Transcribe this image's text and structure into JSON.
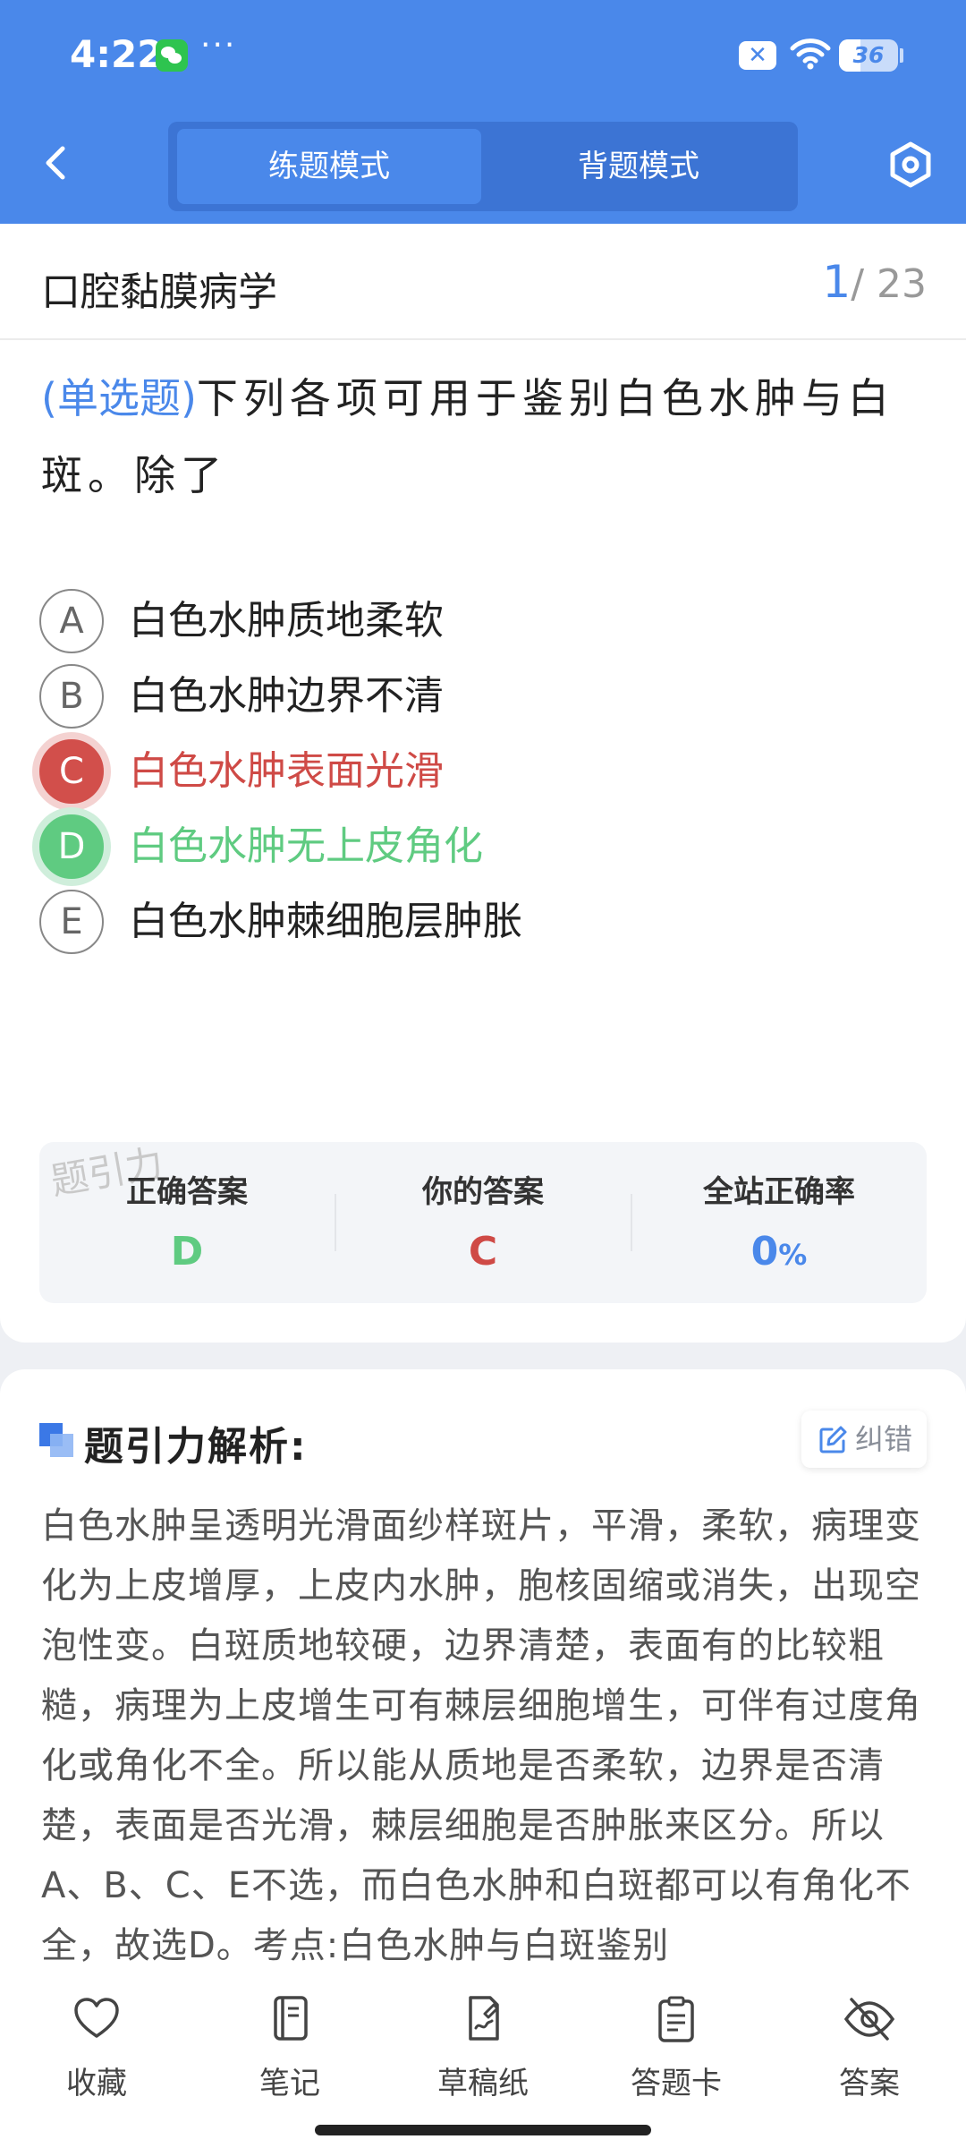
{
  "status_bar": {
    "time": "4:22",
    "dots": "···",
    "battery_level": "36",
    "battery_fraction": 0.36
  },
  "header": {
    "modes": [
      "练题模式",
      "背题模式"
    ],
    "active_mode": "练题模式",
    "back_icon": "chevron-left-icon",
    "settings_icon": "hexagon-settings-icon",
    "bg_color": "#4a88ea"
  },
  "question": {
    "subject": "口腔黏膜病学",
    "current": "1",
    "total": "/ 23",
    "type_label": "(单选题)",
    "text": "下列各项可用于鉴别白色水肿与白斑。除了",
    "options": [
      {
        "letter": "A",
        "text": "白色水肿质地柔软",
        "state": "normal"
      },
      {
        "letter": "B",
        "text": "白色水肿边界不清",
        "state": "normal"
      },
      {
        "letter": "C",
        "text": "白色水肿表面光滑",
        "state": "wrong"
      },
      {
        "letter": "D",
        "text": "白色水肿无上皮角化",
        "state": "right"
      },
      {
        "letter": "E",
        "text": "白色水肿棘细胞层肿胀",
        "state": "normal"
      }
    ]
  },
  "answer_box": {
    "watermark": "题引力",
    "correct_label": "正确答案",
    "correct_value": "D",
    "yours_label": "你的答案",
    "yours_value": "C",
    "rate_label": "全站正确率",
    "rate_value": "0",
    "rate_unit": "%",
    "colors": {
      "correct": "#5fcb81",
      "wrong": "#cf4a46",
      "rate": "#4a88ea"
    }
  },
  "analysis": {
    "title": "题引力解析:",
    "report_label": "纠错",
    "body": "白色水肿呈透明光滑面纱样斑片，平滑，柔软，病理变化为上皮增厚，上皮内水肿，胞核固缩或消失，出现空泡性变。白斑质地较硬，边界清楚，表面有的比较粗糙，病理为上皮增生可有棘层细胞增生，可伴有过度角化或角化不全。所以能从质地是否柔软，边界是否清楚，表面是否光滑，棘层细胞是否肿胀来区分。所以A、B、C、E不选，而白色水肿和白斑都可以有角化不全，故选D。考点:白色水肿与白斑鉴别"
  },
  "bottom_nav": {
    "items": [
      {
        "label": "收藏",
        "icon": "heart-icon"
      },
      {
        "label": "笔记",
        "icon": "notebook-icon"
      },
      {
        "label": "草稿纸",
        "icon": "draft-paper-icon"
      },
      {
        "label": "答题卡",
        "icon": "clipboard-icon"
      },
      {
        "label": "答案",
        "icon": "eye-off-icon"
      }
    ]
  }
}
